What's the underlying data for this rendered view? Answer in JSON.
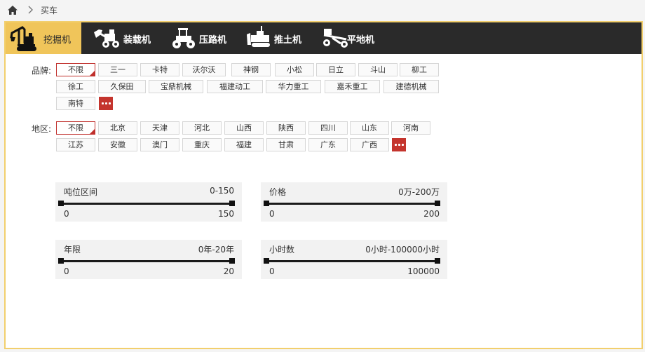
{
  "breadcrumb": {
    "home_icon": "home-icon",
    "separator_icon": "chevron-right-icon",
    "current": "买车"
  },
  "categories": [
    {
      "label": "挖掘机",
      "icon": "excavator-icon",
      "active": true
    },
    {
      "label": "装载机",
      "icon": "loader-icon",
      "active": false
    },
    {
      "label": "压路机",
      "icon": "road-roller-icon",
      "active": false
    },
    {
      "label": "推土机",
      "icon": "bulldozer-icon",
      "active": false
    },
    {
      "label": "平地机",
      "icon": "grader-icon",
      "active": false
    }
  ],
  "filters": {
    "brand": {
      "label": "品牌:",
      "options": [
        "不限",
        "三一",
        "卡特",
        "沃尔沃",
        "神钢",
        "小松",
        "日立",
        "斗山",
        "柳工",
        "徐工",
        "久保田",
        "宝鼎机械",
        "福建动工",
        "华力重工",
        "嘉禾重工",
        "建德机械",
        "南特"
      ],
      "selected": "不限",
      "more_icon": "more-dots-icon"
    },
    "region": {
      "label": "地区:",
      "options": [
        "不限",
        "北京",
        "天津",
        "河北",
        "山西",
        "陕西",
        "四川",
        "山东",
        "河南",
        "江苏",
        "安徽",
        "澳门",
        "重庆",
        "福建",
        "甘肃",
        "广东",
        "广西"
      ],
      "selected": "不限",
      "more_icon": "more-dots-icon"
    }
  },
  "ranges": [
    {
      "title": "吨位区间",
      "value_text": "0-150",
      "min": "0",
      "max": "150",
      "selected_low": 0,
      "selected_high": 150
    },
    {
      "title": "价格",
      "value_text": "0万-200万",
      "min": "0",
      "max": "200",
      "selected_low": 0,
      "selected_high": 200
    },
    {
      "title": "年限",
      "value_text": "0年-20年",
      "min": "0",
      "max": "20",
      "selected_low": 0,
      "selected_high": 20
    },
    {
      "title": "小时数",
      "value_text": "0小时-100000小时",
      "min": "0",
      "max": "100000",
      "selected_low": 0,
      "selected_high": 100000
    }
  ],
  "colors": {
    "accent_yellow": "#f0c55a",
    "nav_dark": "#2a2a2a",
    "selected_red": "#c0302c",
    "frame_border": "#f2cf6d"
  }
}
